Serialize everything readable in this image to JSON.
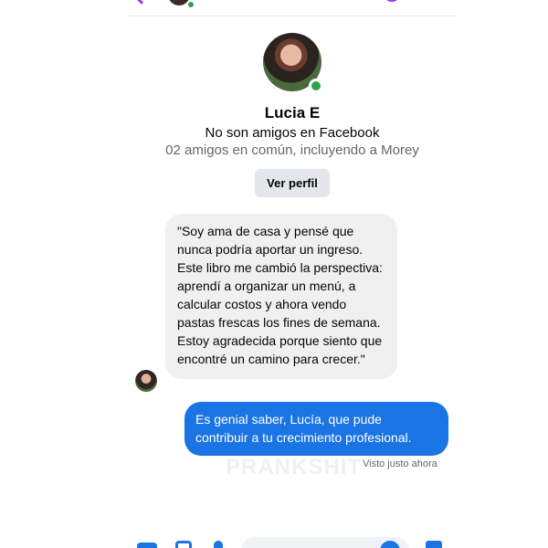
{
  "contact": {
    "name": "Lucia E",
    "relation": "No son amigos en Facebook",
    "mutual": "02 amigos en común, incluyendo a Morey"
  },
  "profile_button": "Ver perfil",
  "messages": [
    {
      "direction": "incoming",
      "text": "\"Soy ama de casa y pensé que nunca podría aportar un ingreso. Este libro me cambió la perspectiva: aprendí a organizar un menú, a calcular costos y ahora vendo pastas frescas los fines de semana. Estoy agradecida porque siento que encontré un camino para crecer.\""
    },
    {
      "direction": "outgoing",
      "text": "Es genial saber, Lucía, que pude contribuir a tu crecimiento profesional."
    }
  ],
  "seen_status": "Visto justo ahora",
  "watermark": "PRANKSHIT",
  "colors": {
    "accent": "#a033ff",
    "outgoing_bubble": "#1b74e4",
    "incoming_bubble": "#f0f0f0",
    "online": "#31a24c"
  },
  "icons": [
    "back-icon",
    "call-icon",
    "video-icon",
    "camera-icon",
    "gallery-icon",
    "mic-icon",
    "emoji-icon",
    "like-icon"
  ]
}
